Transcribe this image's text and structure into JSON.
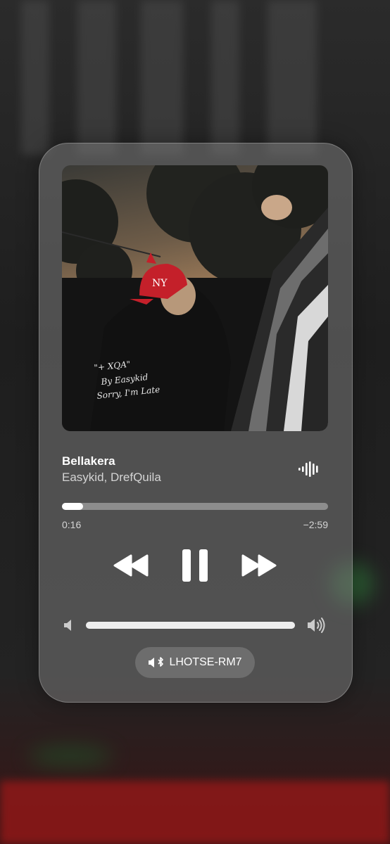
{
  "now_playing": {
    "title": "Bellakera",
    "artist": "Easykid, DrefQuila",
    "artwork_caption": [
      "\"+ XQA\"",
      "By Easykid",
      "Sorry, I'm Late"
    ],
    "elapsed": "0:16",
    "remaining": "−2:59",
    "progress_fraction": 0.08,
    "is_playing": true
  },
  "volume": {
    "level_fraction": 1.0
  },
  "output_route": {
    "device_name": "LHOTSE-RM7",
    "icon": "speaker-bluetooth-icon"
  },
  "icons": {
    "waveform": "waveform-icon",
    "rewind": "backward-icon",
    "pause": "pause-icon",
    "forward": "forward-icon",
    "volume_low": "speaker-low-icon",
    "volume_high": "speaker-high-icon"
  },
  "colors": {
    "card_bg": "#787878",
    "text_primary": "#ffffff",
    "text_secondary": "#bfbfbf",
    "background_red": "#8a1818"
  }
}
